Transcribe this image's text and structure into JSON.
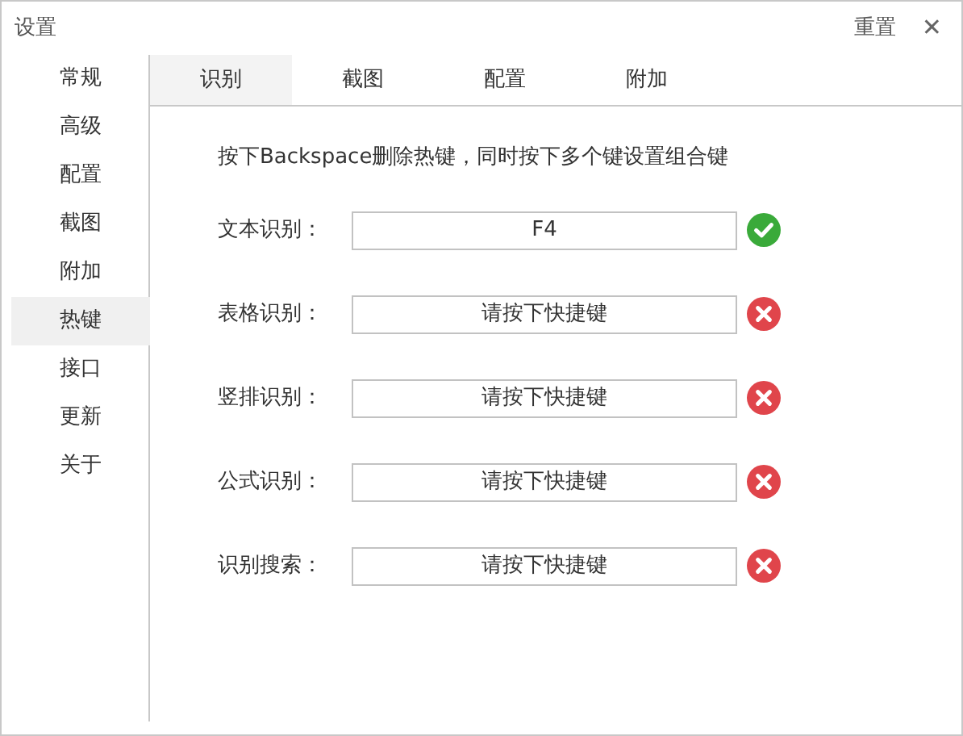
{
  "window": {
    "title": "设置",
    "reset_label": "重置",
    "close_label": "✕"
  },
  "sidebar": {
    "items": [
      {
        "label": "常规",
        "selected": false
      },
      {
        "label": "高级",
        "selected": false
      },
      {
        "label": "配置",
        "selected": false
      },
      {
        "label": "截图",
        "selected": false
      },
      {
        "label": "附加",
        "selected": false
      },
      {
        "label": "热键",
        "selected": true
      },
      {
        "label": "接口",
        "selected": false
      },
      {
        "label": "更新",
        "selected": false
      },
      {
        "label": "关于",
        "selected": false
      }
    ]
  },
  "tabs": [
    {
      "label": "识别",
      "selected": true
    },
    {
      "label": "截图",
      "selected": false
    },
    {
      "label": "配置",
      "selected": false
    },
    {
      "label": "附加",
      "selected": false
    }
  ],
  "hint": "按下Backspace删除热键，同时按下多个键设置组合键",
  "hotkeys": [
    {
      "label": "文本识别：",
      "value": "F4",
      "valid": true
    },
    {
      "label": "表格识别：",
      "value": "请按下快捷键",
      "valid": false
    },
    {
      "label": "竖排识别：",
      "value": "请按下快捷键",
      "valid": false
    },
    {
      "label": "公式识别：",
      "value": "请按下快捷键",
      "valid": false
    },
    {
      "label": "识别搜索：",
      "value": "请按下快捷键",
      "valid": false
    }
  ]
}
